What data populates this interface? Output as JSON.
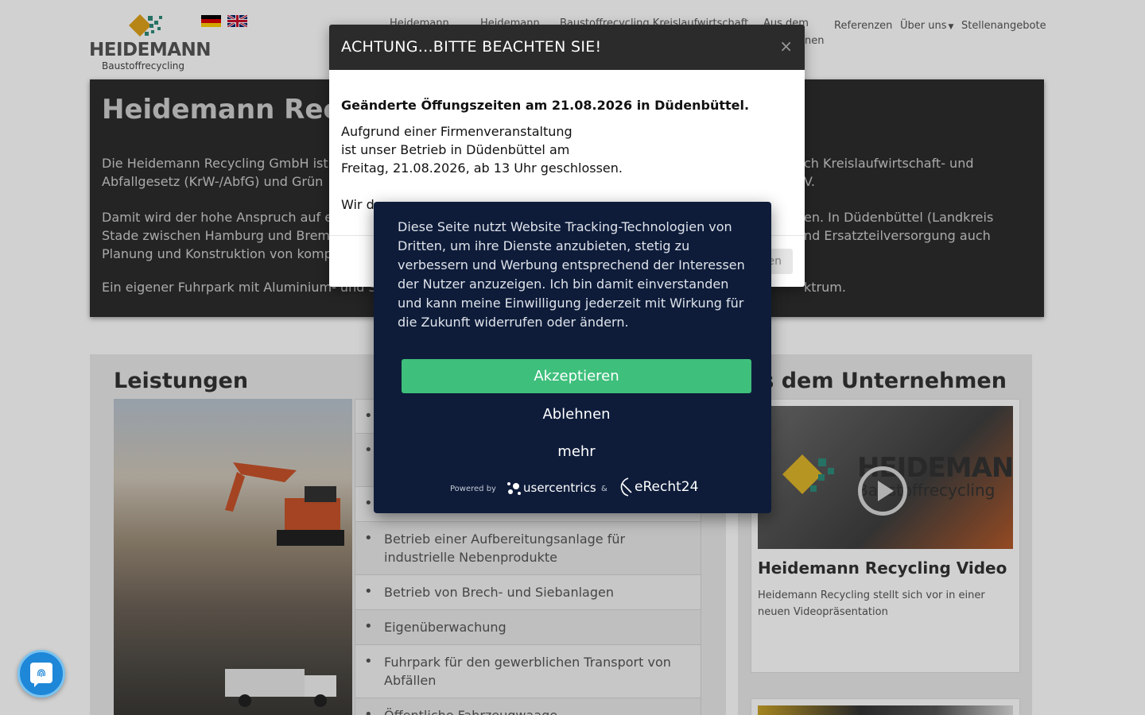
{
  "header": {
    "logo_word": "HEIDEMANN",
    "logo_sub": "Baustoffrecycling",
    "nav": [
      {
        "label": "Referenzen"
      },
      {
        "label": "Über uns"
      },
      {
        "label": "Stellenangebote"
      }
    ],
    "nav_partial": [
      {
        "label": "Heidemann"
      },
      {
        "label": "Heidemann"
      },
      {
        "label": "Baustoffrecycling Kreislaufwirtschaft"
      },
      {
        "label": "Aus dem"
      },
      {
        "label": "nen"
      }
    ]
  },
  "hero": {
    "title": "Heidemann Rec",
    "p1": "Die Heidemann Recycling GmbH ist",
    "p1b": "Abfallgesetz (KrW-/AbfG) und Grün",
    "p1_right": "ch Kreislaufwirtschaft- und",
    "p1b_right": "V.",
    "p2": "Damit wird der hohe Anspruch auf e",
    "p2b": "Stade zwischen Hamburg und Brem",
    "p2c": "Planung und Konstruktion von komp",
    "p2_right": "en. In Düdenbüttel (Landkreis",
    "p2b_right": "nd Ersatzteilversorgung auch",
    "p3": "Ein eigener Fuhrpark mit Aluminium- und S",
    "p3_right": "ktrum."
  },
  "services": {
    "title": "Leistungen",
    "items": [
      "",
      "",
      "",
      "Betrieb einer Aufbereitungsanlage für industrielle Nebenprodukte",
      "Betrieb von Brech- und Siebanlagen",
      "Eigenüberwachung",
      "Fuhrpark für den gewerblichen Transport von Abfällen",
      "Öffentliche Fahrzeugwaage"
    ]
  },
  "news": {
    "title": "us dem Unternehmen",
    "video_logo": "HEIDEMANN",
    "video_sub": "Baustoffrecycling",
    "card_title": "Heidemann Recycling Video",
    "card_text": "Heidemann Recycling stellt sich vor in einer neuen Videopräsentation"
  },
  "modal": {
    "title": "ACHTUNG...BITTE BEACHTEN SIE!",
    "close": "×",
    "lead": "Geänderte Öffungszeiten am 21.08.2026 in Düdenbüttel.",
    "line1": "Aufgrund einer Firmenveranstaltung",
    "line2": "ist unser Betrieb in Düdenbüttel am",
    "line3": "Freitag, 21.08.2026, ab 13 Uhr geschlossen.",
    "line4": "Wir d",
    "button": "en"
  },
  "consent": {
    "text": "Diese Seite nutzt Website Tracking-Technologien von Dritten, um ihre Dienste anzubieten, stetig zu verbessern und Werbung entsprechend der Interessen der Nutzer anzuzeigen. Ich bin damit einverstanden und kann meine Einwilligung jederzeit mit Wirkung für die Zukunft widerrufen oder ändern.",
    "accept": "Akzeptieren",
    "deny": "Ablehnen",
    "more": "mehr",
    "powered": "Powered by",
    "usercentrics": "usercentrics",
    "amp": "&",
    "erecht": "eRecht24",
    "accent": "#3ebf7c",
    "background": "#0e1c3a"
  }
}
